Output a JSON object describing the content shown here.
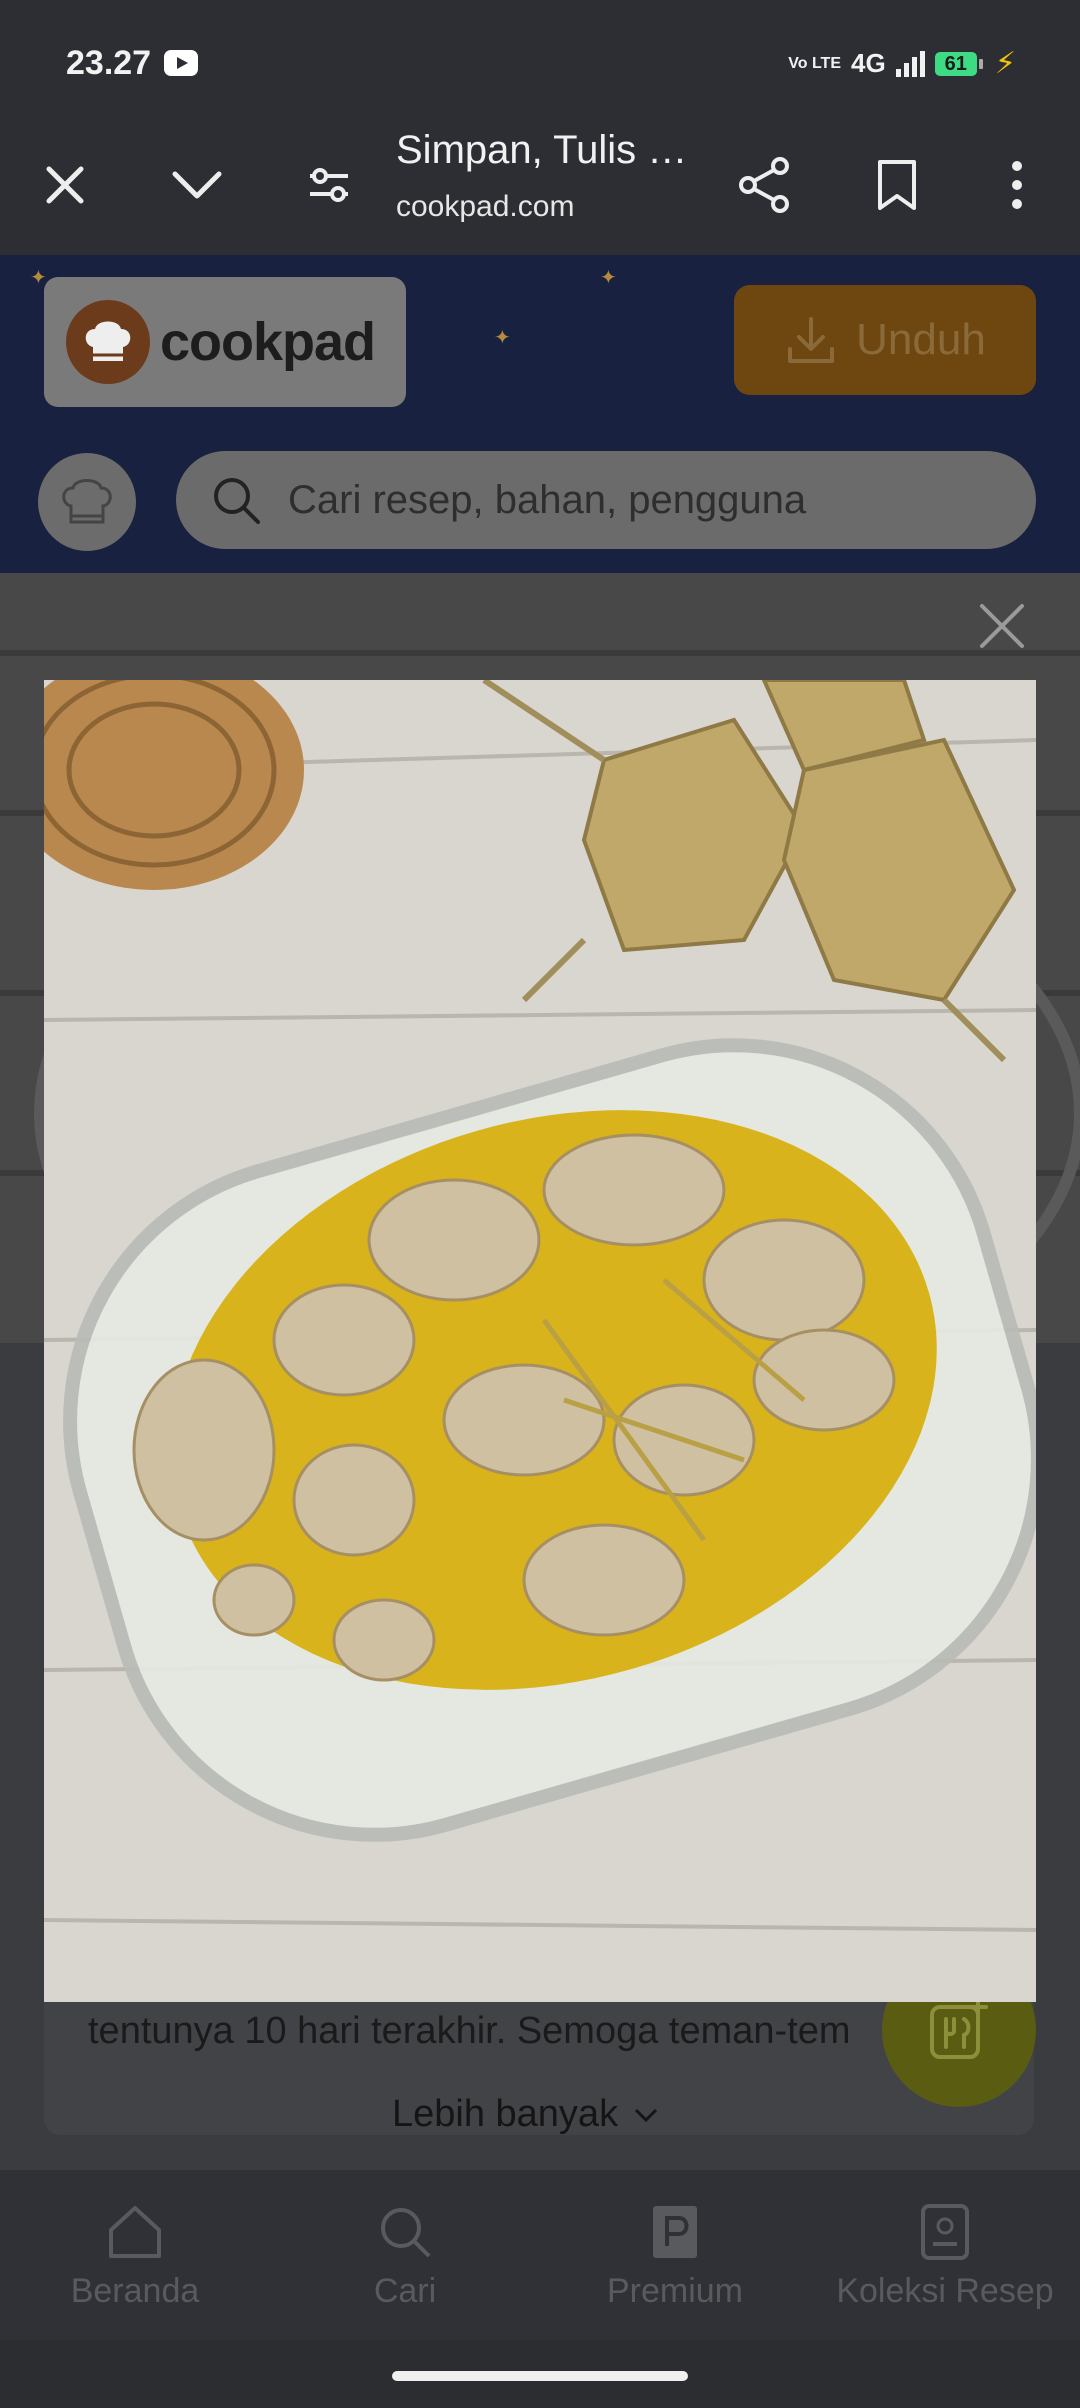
{
  "status_bar": {
    "time": "23.27",
    "volte": "Vo LTE",
    "network": "4G",
    "battery": "61"
  },
  "toolbar": {
    "title": "Simpan, Tulis …",
    "url": "cookpad.com"
  },
  "header": {
    "logo_text": "cookpad",
    "download_label": "Unduh",
    "search_placeholder": "Cari resep, bahan, pengguna"
  },
  "content": {
    "description": "tentunya 10 hari terakhir. Semoga teman-tem",
    "more_label": "Lebih banyak"
  },
  "bottom_nav": [
    {
      "label": "Beranda",
      "icon": "home-icon"
    },
    {
      "label": "Cari",
      "icon": "search-icon"
    },
    {
      "label": "Premium",
      "icon": "premium-icon"
    },
    {
      "label": "Koleksi Resep",
      "icon": "collection-icon"
    }
  ],
  "colors": {
    "brand": "#ff9d00",
    "fab": "#5a5c12",
    "header_bg": "#18213f"
  }
}
